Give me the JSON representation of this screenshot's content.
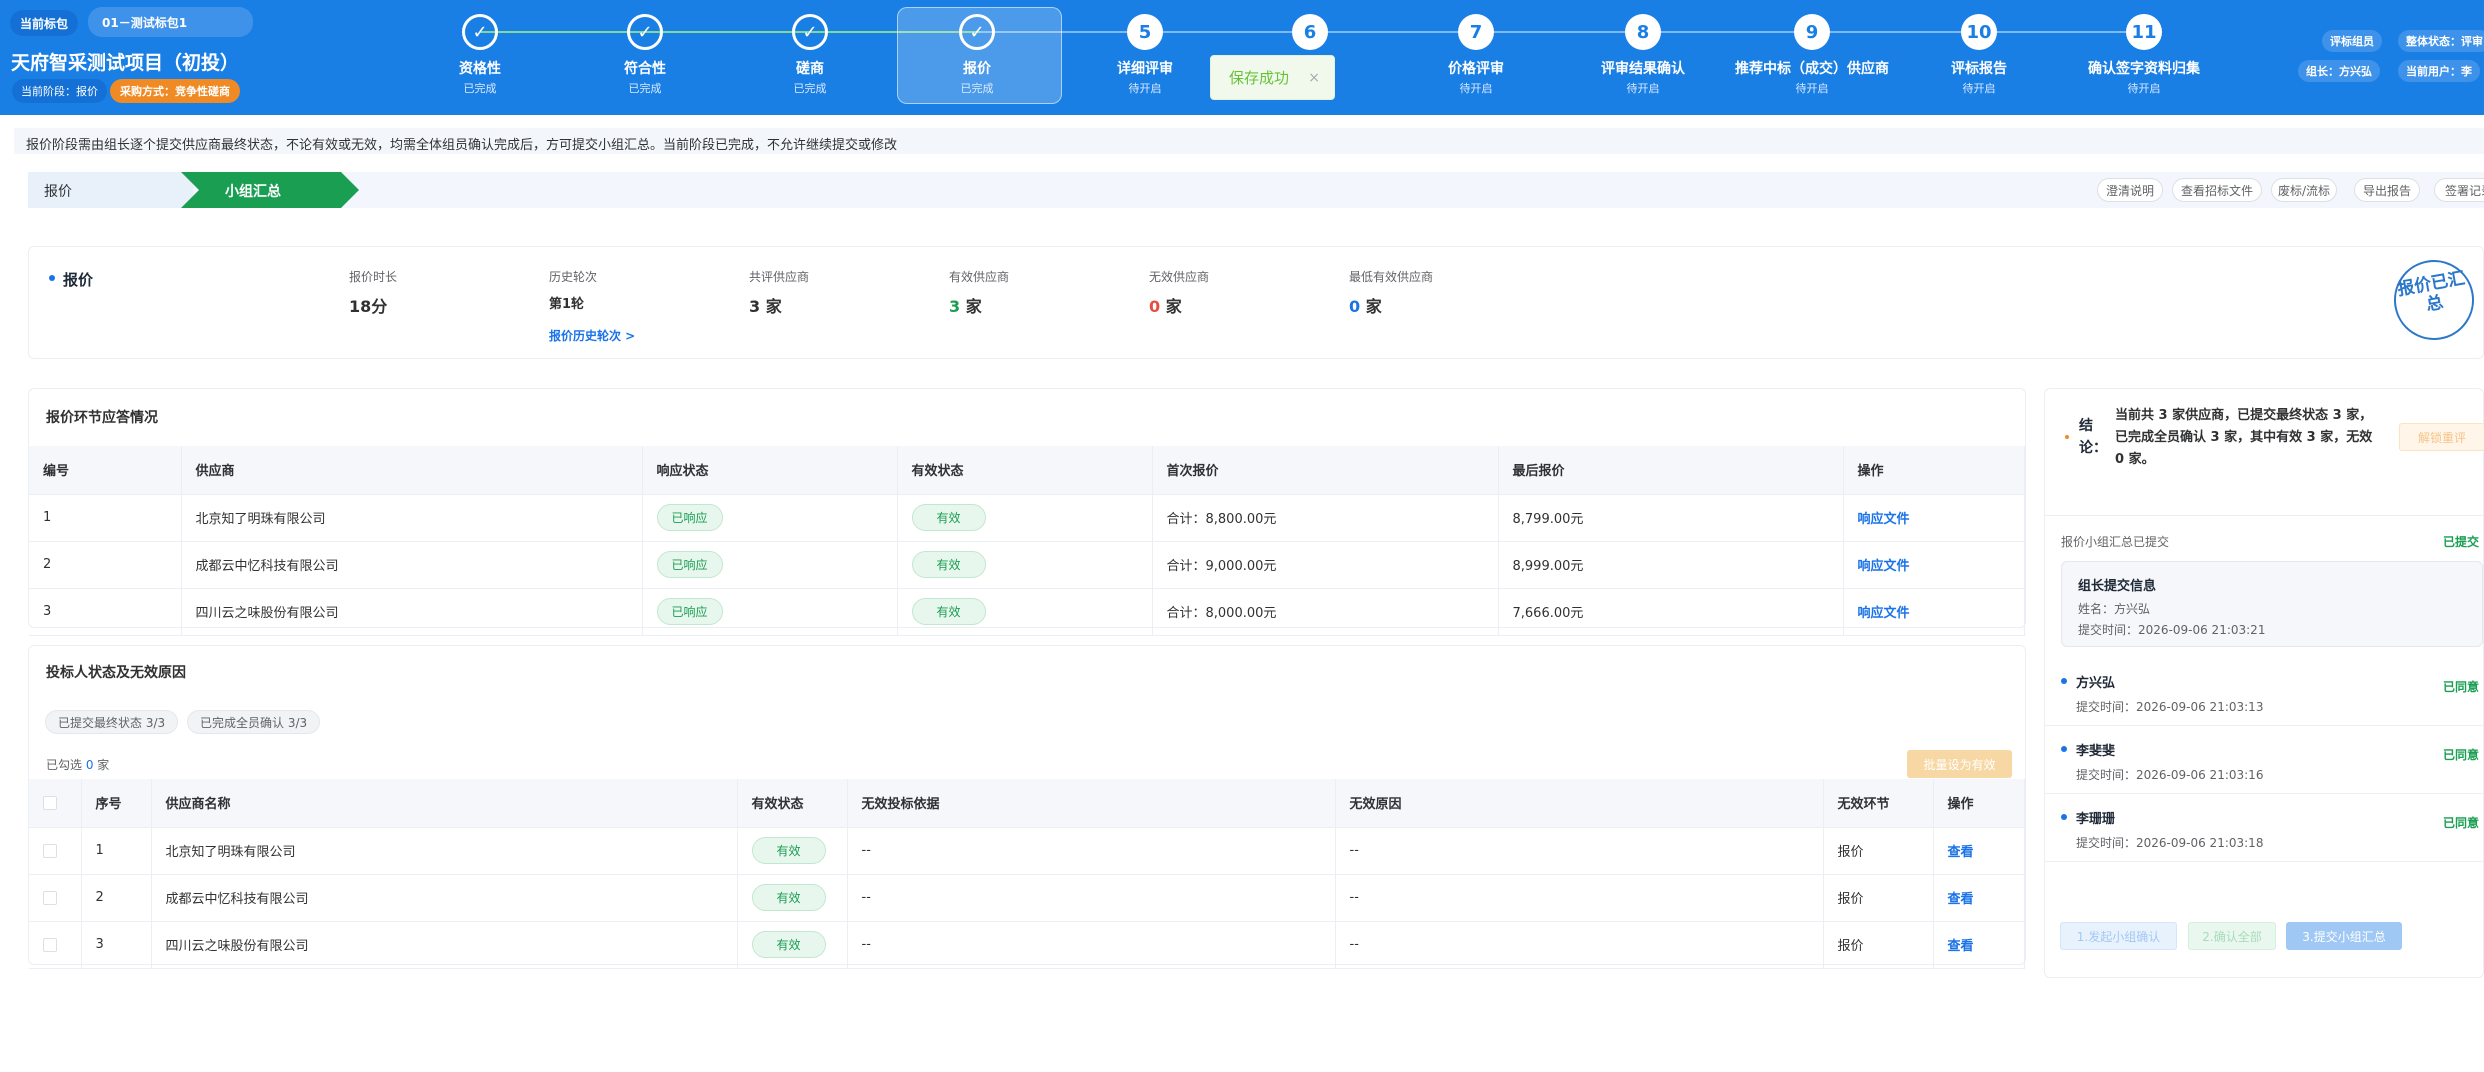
{
  "header": {
    "current_package_label": "当前标包",
    "current_package_value": "01－测试标包1",
    "project_title": "天府智采测试项目（初投）",
    "current_stage": "当前阶段：报价",
    "procurement_method": "采购方式：竞争性磋商",
    "right_badges": [
      "评标组员",
      "整体状态：评审",
      "组长：方兴弘",
      "当前用户：李"
    ]
  },
  "steps": [
    {
      "label": "资格性",
      "status": "已完成",
      "state": "done"
    },
    {
      "label": "符合性",
      "status": "已完成",
      "state": "done"
    },
    {
      "label": "磋商",
      "status": "已完成",
      "state": "done"
    },
    {
      "label": "报价",
      "status": "已完成",
      "state": "done",
      "active": true
    },
    {
      "num": "5",
      "label": "详细评审",
      "status": "待开启",
      "state": "todo"
    },
    {
      "num": "6",
      "label": "",
      "status": "",
      "state": "todo"
    },
    {
      "num": "7",
      "label": "价格评审",
      "status": "待开启",
      "state": "todo"
    },
    {
      "num": "8",
      "label": "评审结果确认",
      "status": "待开启",
      "state": "todo"
    },
    {
      "num": "9",
      "label": "推荐中标（成交）供应商",
      "status": "待开启",
      "state": "todo"
    },
    {
      "num": "10",
      "label": "评标报告",
      "status": "待开启",
      "state": "todo"
    },
    {
      "num": "11",
      "label": "确认签字资料归集",
      "status": "待开启",
      "state": "todo"
    }
  ],
  "toast": {
    "text": "保存成功",
    "close": "×"
  },
  "notice": "报价阶段需由组长逐个提交供应商最终状态，不论有效或无效，均需全体组员确认完成后，方可提交小组汇总。当前阶段已完成，不允许继续提交或修改",
  "breadcrumb": {
    "stage": "报价",
    "sub": "小组汇总"
  },
  "actions": [
    "澄清说明",
    "查看招标文件",
    "废标/流标",
    "导出报告",
    "签署记录"
  ],
  "summary": {
    "title": "报价",
    "fields": [
      {
        "label": "报价时长",
        "value": "18分"
      },
      {
        "label": "历史轮次",
        "value": "第1轮"
      },
      {
        "label": "共评供应商",
        "num": "3",
        "unit": "家"
      },
      {
        "label": "有效供应商",
        "num": "3",
        "unit": "家"
      },
      {
        "label": "无效供应商",
        "num": "0",
        "unit": "家"
      },
      {
        "label": "最低有效供应商",
        "num": "0",
        "unit": "家"
      }
    ],
    "history_link": "报价历史轮次 >",
    "stamp": "报价已汇总"
  },
  "response_table": {
    "title": "报价环节应答情况",
    "headers": [
      "编号",
      "供应商",
      "响应状态",
      "有效状态",
      "首次报价",
      "最后报价",
      "操作"
    ],
    "rows": [
      [
        "1",
        "北京知了明珠有限公司",
        "已响应",
        "有效",
        "合计：8,800.00元",
        "8,799.00元",
        "响应文件"
      ],
      [
        "2",
        "成都云中忆科技有限公司",
        "已响应",
        "有效",
        "合计：9,000.00元",
        "8,999.00元",
        "响应文件"
      ],
      [
        "3",
        "四川云之味股份有限公司",
        "已响应",
        "有效",
        "合计：8,000.00元",
        "7,666.00元",
        "响应文件"
      ]
    ]
  },
  "bidder_table": {
    "title": "投标人状态及无效原因",
    "tags": [
      "已提交最终状态 3/3",
      "已完成全员确认 3/3"
    ],
    "selected_prefix": "已勾选 ",
    "selected_count": "0",
    "selected_suffix": " 家",
    "batch_button": "批量设为有效",
    "headers": [
      "序号",
      "供应商名称",
      "有效状态",
      "无效投标依据",
      "无效原因",
      "无效环节",
      "操作"
    ],
    "rows": [
      [
        "1",
        "北京知了明珠有限公司",
        "有效",
        "--",
        "--",
        "报价",
        "查看"
      ],
      [
        "2",
        "成都云中忆科技有限公司",
        "有效",
        "--",
        "--",
        "报价",
        "查看"
      ],
      [
        "3",
        "四川云之味股份有限公司",
        "有效",
        "--",
        "--",
        "报价",
        "查看"
      ]
    ]
  },
  "right_panel": {
    "conclusion_label": "结论：",
    "conclusion": "当前共 3 家供应商，已提交最终状态 3 家，已完成全员确认 3 家，其中有效 3 家，无效 0 家。",
    "unlock_button": "解锁重评",
    "summary_status_label": "报价小组汇总已提交",
    "summary_status": "已提交",
    "leader_box_title": "组长提交信息",
    "leader_name": "姓名：方兴弘",
    "leader_time": "提交时间：2026-09-06 21:03:21",
    "members": [
      {
        "name": "方兴弘",
        "time": "提交时间：2026-09-06 21:03:13",
        "status": "已同意"
      },
      {
        "name": "李斐斐",
        "time": "提交时间：2026-09-06 21:03:16",
        "status": "已同意"
      },
      {
        "name": "李珊珊",
        "time": "提交时间：2026-09-06 21:03:18",
        "status": "已同意"
      }
    ],
    "step_buttons": [
      "1.发起小组确认",
      "2.确认全部",
      "3.提交小组汇总"
    ]
  }
}
